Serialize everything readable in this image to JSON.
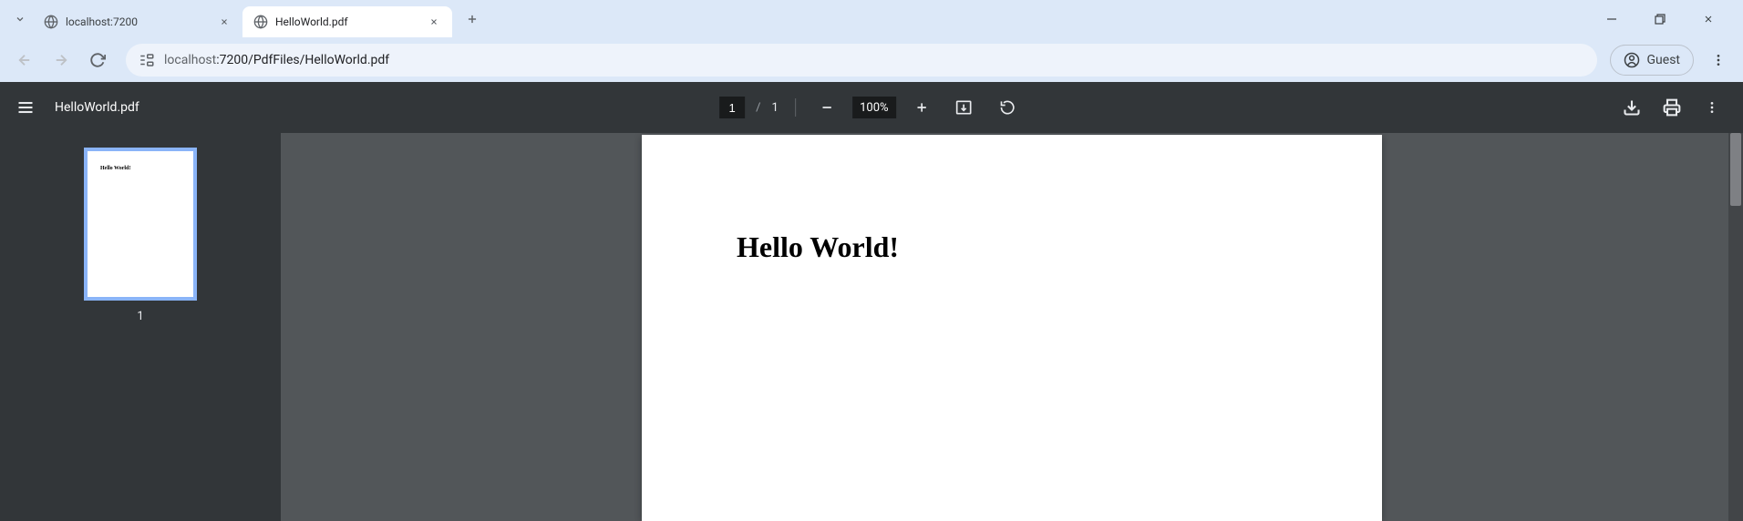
{
  "browser": {
    "tabs": [
      {
        "title": "localhost:7200",
        "active": false
      },
      {
        "title": "HelloWorld.pdf",
        "active": true
      }
    ],
    "address": {
      "host": "localhost",
      "port": ":7200",
      "path": "/PdfFiles/HelloWorld.pdf"
    },
    "profile_label": "Guest"
  },
  "pdf": {
    "filename": "HelloWorld.pdf",
    "current_page": "1",
    "total_pages": "1",
    "zoom": "100%",
    "page_text": "Hello World!",
    "thumb_text": "Hello World!",
    "thumb_label": "1"
  }
}
